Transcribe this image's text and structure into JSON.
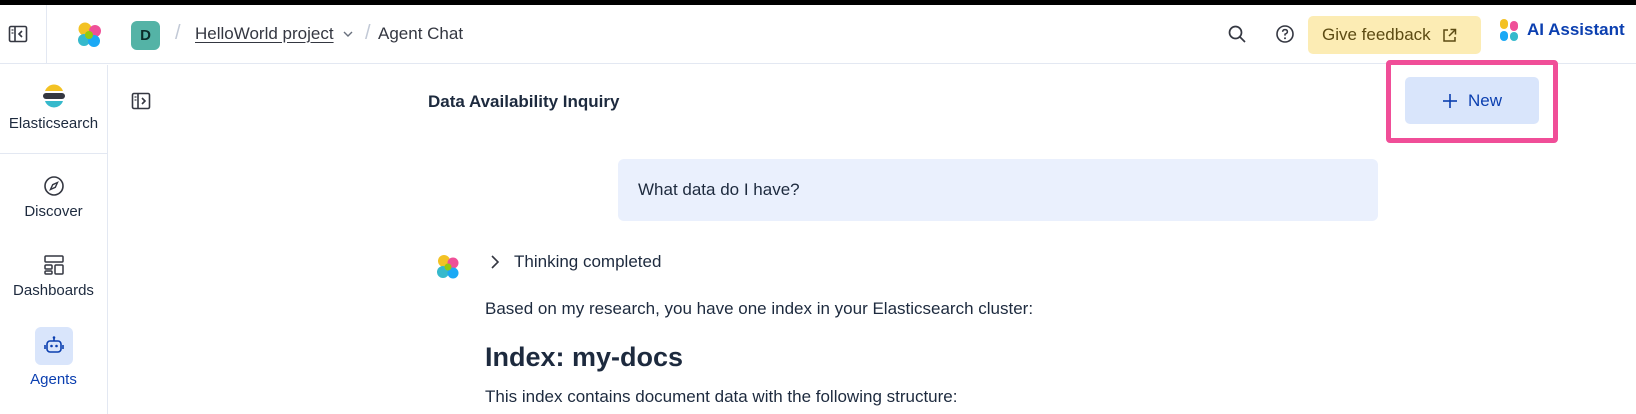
{
  "breadcrumb": {
    "project_initial": "D",
    "project_name": "HelloWorld project",
    "page": "Agent Chat"
  },
  "header": {
    "feedback_label": "Give feedback",
    "assistant_label": "AI Assistant"
  },
  "nav": {
    "solution_label": "Elasticsearch",
    "items": [
      {
        "label": "Discover",
        "icon": "compass-icon"
      },
      {
        "label": "Dashboards",
        "icon": "dashboards-icon"
      },
      {
        "label": "Agents",
        "icon": "robot-icon",
        "active": true
      }
    ]
  },
  "conversation": {
    "title": "Data Availability Inquiry",
    "new_label": "New",
    "user_message": "What data do I have?",
    "thinking_label": "Thinking completed",
    "answer_intro": "Based on my research, you have one index in your Elasticsearch cluster:",
    "answer_heading": "Index: my-docs",
    "answer_body": "This index contains document data with the following structure:"
  },
  "colors": {
    "accent": "#0b3fb0",
    "feedback_bg": "#fcecb4",
    "highlight": "#f04e98",
    "user_bubble": "#eaf0fd",
    "project_avatar": "#54b3a6"
  }
}
